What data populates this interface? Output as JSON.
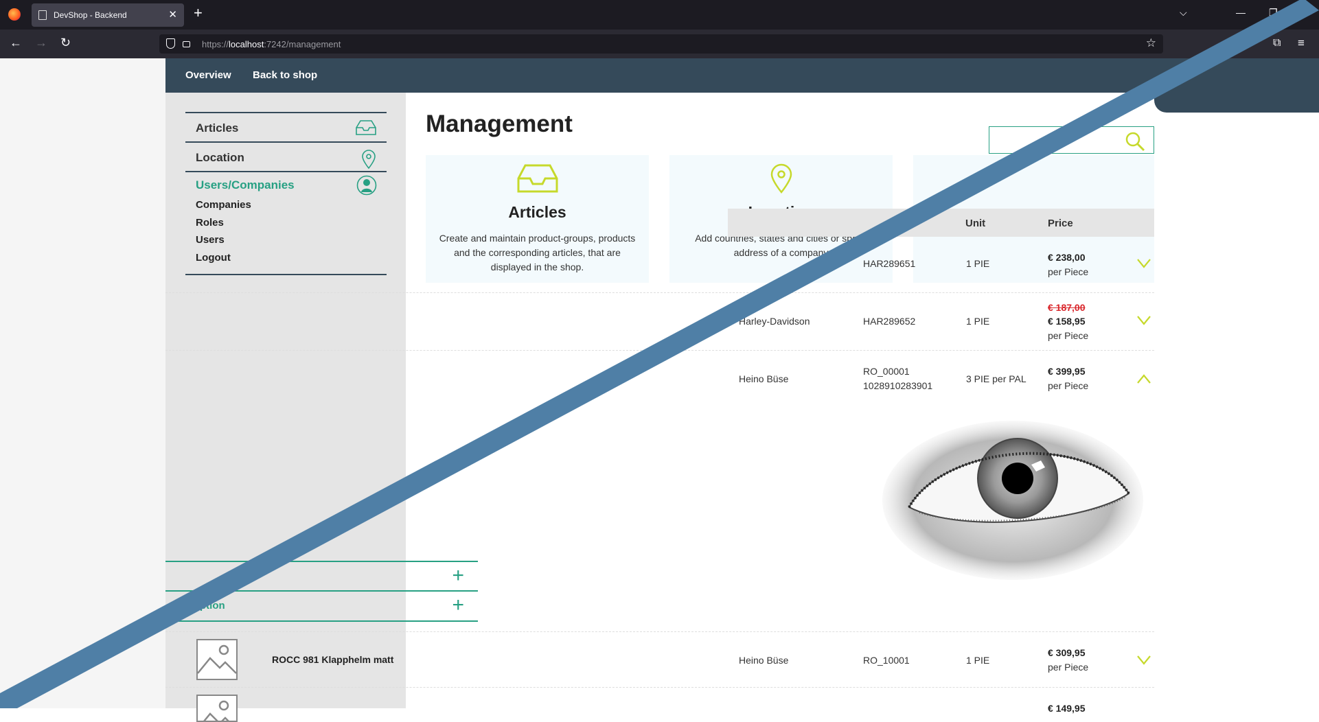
{
  "browser": {
    "tab_title": "DevShop - Backend",
    "url_prefix": "https://",
    "url_host": "localhost",
    "url_rest": ":7242/management"
  },
  "topnav": {
    "overview": "Overview",
    "back": "Back to shop"
  },
  "sidebar": {
    "items": [
      {
        "label": "Articles"
      },
      {
        "label": "Location"
      },
      {
        "label": "Users/Companies"
      }
    ],
    "subitems": [
      "Companies",
      "Roles",
      "Users",
      "Logout"
    ]
  },
  "main": {
    "title": "Management",
    "cards": [
      {
        "title": "Articles",
        "desc": "Create and maintain product-groups, products and the corresponding articles, that are displayed in the shop."
      },
      {
        "title": "Location",
        "desc": "Add countries, states and cities or specif address of a company"
      }
    ]
  },
  "table": {
    "headers": {
      "unit": "Unit",
      "price": "Price"
    },
    "rows": [
      {
        "number": "HAR289651",
        "unit": "1 PIE",
        "price": "€ 238,00",
        "per": "per Piece"
      },
      {
        "supplier": "Harley-Davidson",
        "number": "HAR289652",
        "unit": "1 PIE",
        "old_price": "€ 187,00",
        "price": "€ 158,95",
        "per": "per Piece"
      },
      {
        "supplier": "Heino Büse",
        "number": "RO_00001",
        "number2": "1028910283901",
        "unit": "3 PIE per PAL",
        "price": "€ 399,95",
        "per": "per Piece"
      },
      {
        "name": "ROCC 981 Klapphelm matt",
        "supplier": "Heino Büse",
        "number": "RO_10001",
        "unit": "1 PIE",
        "price": "€ 309,95",
        "per": "per Piece"
      },
      {
        "price": "€ 149,95"
      }
    ]
  },
  "accordion": {
    "item1": "ation",
    "item2": "ription"
  },
  "colors": {
    "brand_dark": "#354a5a",
    "accent_green": "#27a083",
    "accent_lime": "#c6d92b",
    "sale_red": "#d9262b",
    "overlay_blue": "#4f7fa6"
  }
}
